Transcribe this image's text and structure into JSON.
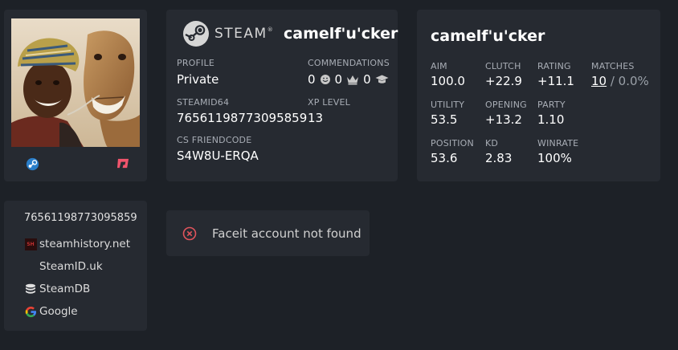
{
  "profile": {
    "username": "camelf'u'cker",
    "steam_brand": "STEAM"
  },
  "steam_card": {
    "profile_label": "PROFILE",
    "profile_value": "Private",
    "commendations_label": "COMMENDATIONS",
    "commendations": {
      "friendly": "0",
      "leader": "0",
      "teacher": "0"
    },
    "steamid64_label": "STEAMID64",
    "steamid64_value": "76561198773095859",
    "xp_label": "XP LEVEL",
    "xp_value": "13",
    "friendcode_label": "CS FRIENDCODE",
    "friendcode_value": "S4W8U-ERQA"
  },
  "stats": {
    "title": "camelf'u'cker",
    "aim_label": "AIM",
    "aim_value": "100.0",
    "clutch_label": "CLUTCH",
    "clutch_value": "+22.9",
    "rating_label": "RATING",
    "rating_value": "+11.1",
    "matches_label": "MATCHES",
    "matches_count": "10",
    "matches_rest": " / 0.0%",
    "utility_label": "UTILITY",
    "utility_value": "53.5",
    "opening_label": "OPENING",
    "opening_value": "+13.2",
    "party_label": "PARTY",
    "party_value": "1.10",
    "position_label": "POSITION",
    "position_value": "53.6",
    "kd_label": "KD",
    "kd_value": "2.83",
    "winrate_label": "WINRATE",
    "winrate_value": "100%"
  },
  "links": {
    "steamid": "76561198773095859",
    "steamhistory": "steamhistory.net",
    "steamid_uk": "SteamID.uk",
    "steamdb": "SteamDB",
    "google": "Google",
    "steamhistory_badge": "SH"
  },
  "faceit": {
    "message": "Faceit account not found"
  },
  "colors": {
    "background": "#1d2127",
    "card": "#262a31",
    "error_red": "#e0545c",
    "leetify_pink": "#f0546c"
  }
}
